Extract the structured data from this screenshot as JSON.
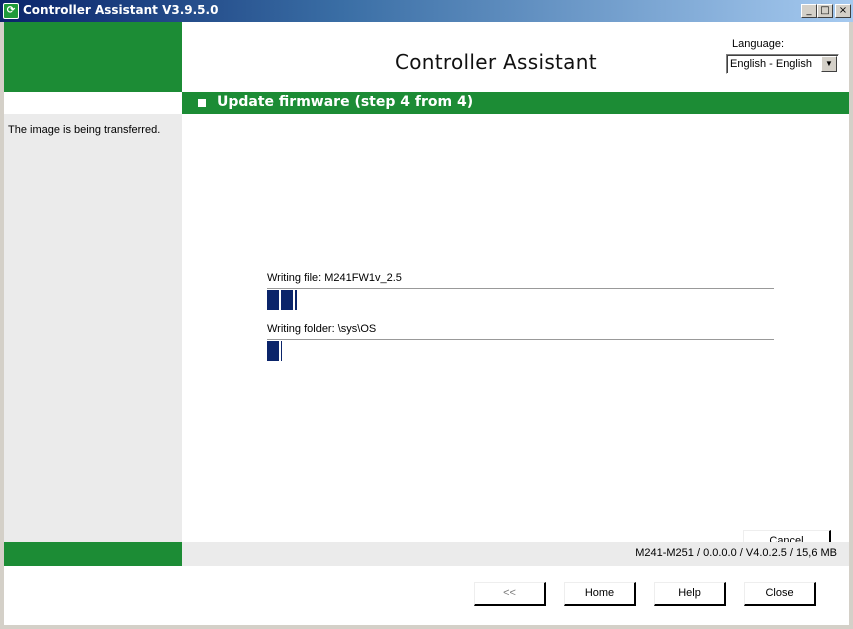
{
  "window": {
    "title": "Controller Assistant V3.9.5.0",
    "controls": {
      "minimize": "_",
      "maximize": "□",
      "close": "×"
    }
  },
  "header": {
    "title": "Controller Assistant",
    "language_label": "Language:",
    "language_value": "English - English"
  },
  "step": {
    "title": "Update firmware (step 4 from 4)"
  },
  "left_panel": {
    "message": "The image is being transferred."
  },
  "progress": {
    "file": {
      "label": "Writing file: M241FW1v_2.5",
      "fraction": 0.06
    },
    "folder": {
      "label": "Writing folder: \\sys\\OS",
      "fraction": 0.03
    }
  },
  "actions": {
    "cancel": "Cancel"
  },
  "status": {
    "text": "M241-M251 / 0.0.0.0 / V4.0.2.5 / 15,6 MB"
  },
  "footer": {
    "back": "<<",
    "home": "Home",
    "help": "Help",
    "close": "Close"
  },
  "icons": {
    "app": "controller-app-icon",
    "language_dropdown": "chevron-down-icon",
    "step_marker": "square-bullet-icon"
  },
  "colors": {
    "brand_green": "#1c8c35",
    "progress_blue": "#0a246a"
  }
}
